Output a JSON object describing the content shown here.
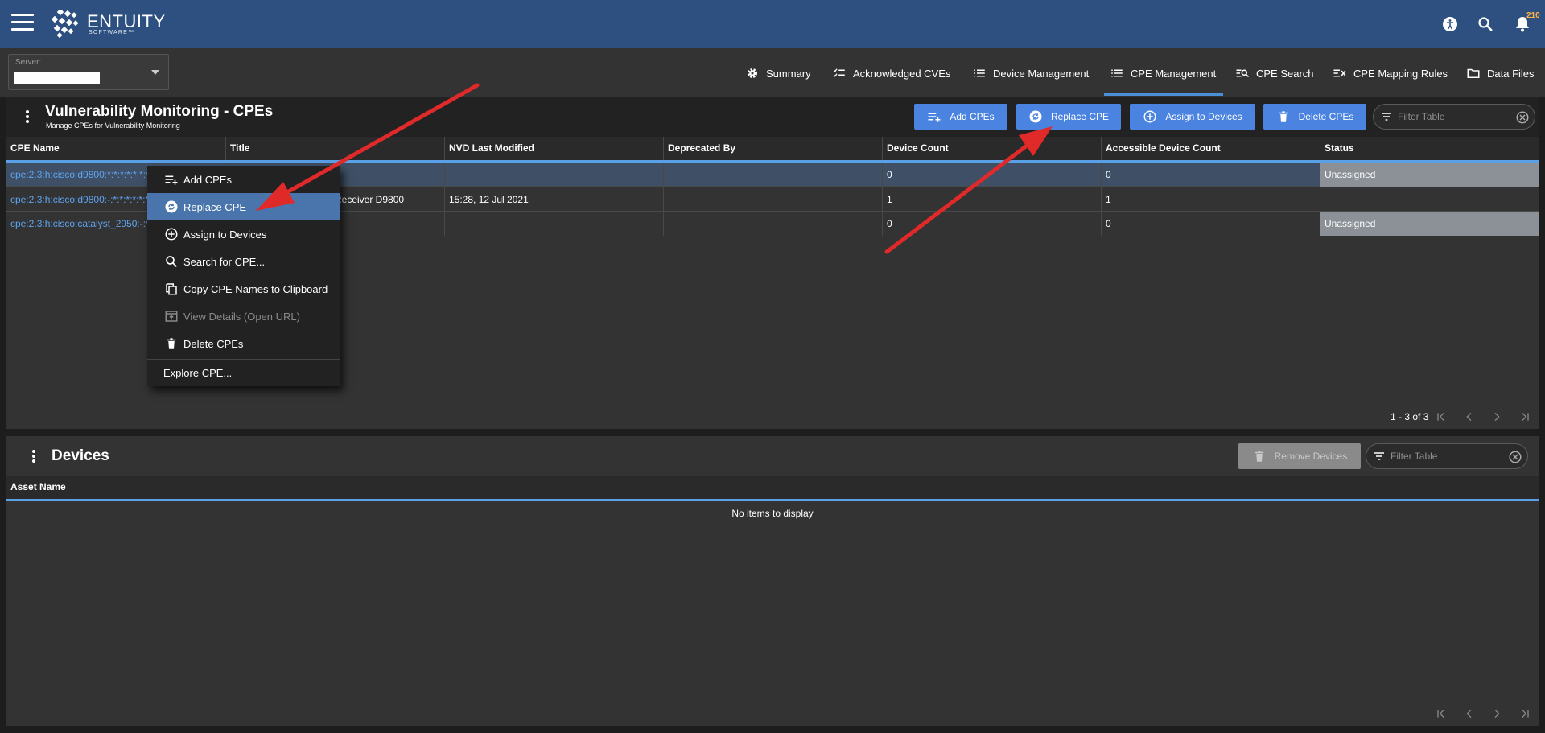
{
  "app": {
    "brand": "ENTUITY",
    "brand_sub": "SOFTWARE™",
    "notification_count": "210"
  },
  "server": {
    "label": "Server:",
    "value": ""
  },
  "nav": {
    "tabs": [
      {
        "label": "Summary",
        "icon": "gear-icon"
      },
      {
        "label": "Acknowledged CVEs",
        "icon": "checklist-icon"
      },
      {
        "label": "Device Management",
        "icon": "list-icon"
      },
      {
        "label": "CPE Management",
        "icon": "list-icon",
        "active": true
      },
      {
        "label": "CPE Search",
        "icon": "list-search-icon"
      },
      {
        "label": "CPE Mapping Rules",
        "icon": "mapping-icon"
      },
      {
        "label": "Data Files",
        "icon": "folder-icon"
      }
    ]
  },
  "cpe_panel": {
    "title": "Vulnerability Monitoring - CPEs",
    "subtitle": "Manage CPEs for Vulnerability Monitoring",
    "buttons": {
      "add": "Add CPEs",
      "replace": "Replace CPE",
      "assign": "Assign to Devices",
      "delete": "Delete CPEs"
    },
    "filter_placeholder": "Filter Table",
    "columns": [
      "CPE Name",
      "Title",
      "NVD Last Modified",
      "Deprecated By",
      "Device Count",
      "Accessible Device Count",
      "Status"
    ],
    "rows": [
      {
        "cpe": "cpe:2.3:h:cisco:d9800:*:*:*:*:*:*:*:*",
        "title": "",
        "nvd": "",
        "deprecated": "",
        "device_count": "0",
        "accessible": "0",
        "status": "Unassigned"
      },
      {
        "cpe": "cpe:2.3:h:cisco:d9800:-:*:*:*:*:*:*:*",
        "title": "Receiver D9800",
        "nvd": "15:28, 12 Jul 2021",
        "deprecated": "",
        "device_count": "1",
        "accessible": "1",
        "status": ""
      },
      {
        "cpe": "cpe:2.3:h:cisco:catalyst_2950:-:*:*:*:*:*:*:*",
        "title": "",
        "nvd": "",
        "deprecated": "",
        "device_count": "0",
        "accessible": "0",
        "status": "Unassigned"
      }
    ],
    "pager": "1 - 3 of 3"
  },
  "context_menu": {
    "items": [
      {
        "label": "Add CPEs",
        "icon": "add-list-icon"
      },
      {
        "label": "Replace CPE",
        "icon": "replace-icon",
        "active": true
      },
      {
        "label": "Assign to Devices",
        "icon": "plus-circle-icon"
      },
      {
        "label": "Search for CPE...",
        "icon": "search-icon"
      },
      {
        "label": "Copy CPE Names to Clipboard",
        "icon": "copy-icon"
      },
      {
        "label": "View Details (Open URL)",
        "icon": "open-url-icon",
        "disabled": true
      },
      {
        "label": "Delete CPEs",
        "icon": "trash-icon"
      },
      {
        "label": "Explore CPE..."
      }
    ]
  },
  "devices_panel": {
    "title": "Devices",
    "remove_button": "Remove Devices",
    "filter_placeholder": "Filter Table",
    "columns": [
      "Asset Name"
    ],
    "empty_message": "No items to display"
  },
  "colors": {
    "topbar": "#2d5080",
    "button": "#4a83e0",
    "link": "#5ea3f0",
    "arrow": "#e02a2a",
    "unassigned": "#8c9097"
  }
}
